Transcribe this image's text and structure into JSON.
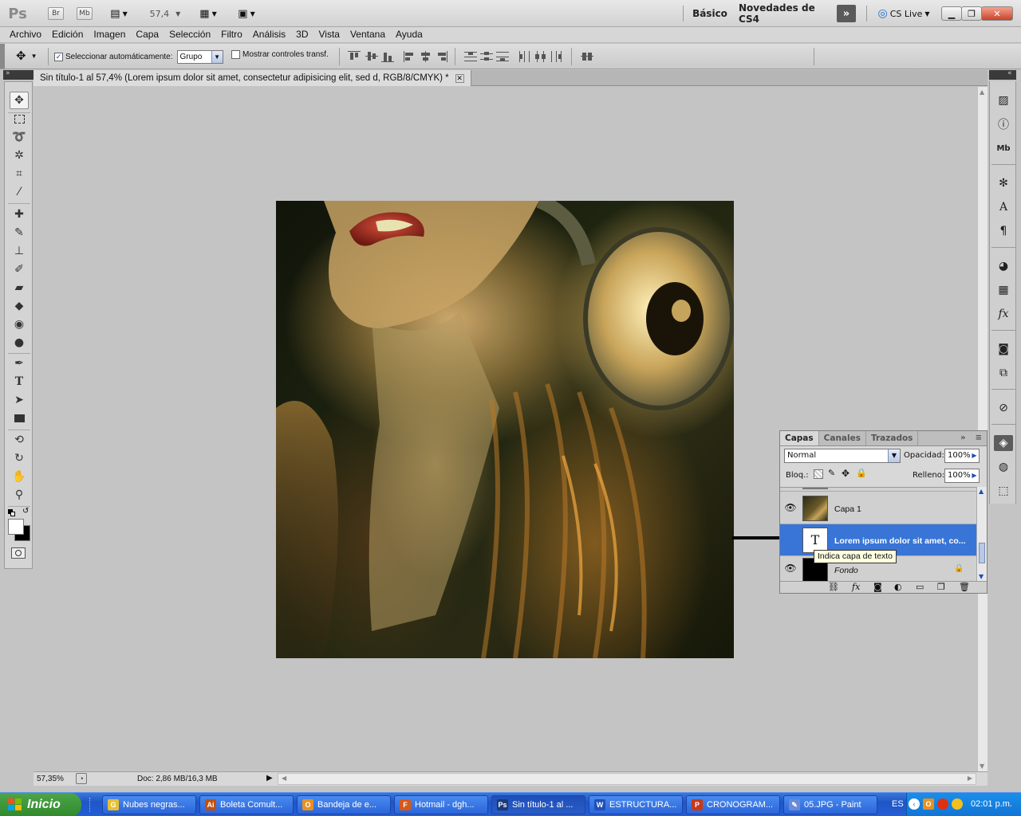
{
  "appbar": {
    "logo": "Ps",
    "bridge_label": "Br",
    "minibridge_label": "Mb",
    "zoom_value": "57,4",
    "workspace_basic": "Básico",
    "workspace_news": "Novedades de CS4",
    "cs_live": "CS Live"
  },
  "menu": [
    "Archivo",
    "Edición",
    "Imagen",
    "Capa",
    "Selección",
    "Filtro",
    "Análisis",
    "3D",
    "Vista",
    "Ventana",
    "Ayuda"
  ],
  "options": {
    "auto_select_label": "Seleccionar automáticamente:",
    "auto_select_checked": true,
    "auto_select_value": "Grupo",
    "show_transform_label": "Mostrar controles transf.",
    "show_transform_checked": false
  },
  "document": {
    "tab_title": "Sin título-1 al 57,4% (Lorem ipsum dolor sit amet, consectetur adipisicing elit, sed d, RGB/8/CMYK) *",
    "status_zoom": "57,35%",
    "status_doc": "Doc: 2,86 MB/16,3 MB"
  },
  "layers_panel": {
    "tabs": [
      "Capas",
      "Canales",
      "Trazados"
    ],
    "blend_mode": "Normal",
    "opacity_label": "Opacidad:",
    "opacity_value": "100%",
    "lock_label": "Bloq.:",
    "fill_label": "Relleno:",
    "fill_value": "100%",
    "layers": [
      {
        "name": "Capa 1",
        "visible": true,
        "selected": false,
        "type": "image"
      },
      {
        "name": "Lorem ipsum dolor sit amet, co...",
        "visible": false,
        "selected": true,
        "type": "text"
      },
      {
        "name": "Fondo",
        "visible": true,
        "selected": false,
        "type": "background",
        "locked": true
      }
    ],
    "tooltip": "Indica capa de texto"
  },
  "taskbar": {
    "start_label": "Inicio",
    "items": [
      {
        "label": "Nubes negras...",
        "icon": "chrome-icon",
        "color": "#e8c030",
        "glyph": "G"
      },
      {
        "label": "Boleta Comult...",
        "icon": "illustrator-icon",
        "color": "#c05010",
        "glyph": "Ai"
      },
      {
        "label": "Bandeja de e...",
        "icon": "outlook-icon",
        "color": "#e89020",
        "glyph": "O"
      },
      {
        "label": "Hotmail - dgh...",
        "icon": "firefox-icon",
        "color": "#d85818",
        "glyph": "F"
      },
      {
        "label": "Sin título-1 al ...",
        "icon": "photoshop-icon",
        "color": "#1a3a78",
        "glyph": "Ps",
        "active": true
      },
      {
        "label": "ESTRUCTURA...",
        "icon": "word-icon",
        "color": "#2050b8",
        "glyph": "W"
      },
      {
        "label": "CRONOGRAM...",
        "icon": "powerpoint-icon",
        "color": "#c83818",
        "glyph": "P"
      },
      {
        "label": "05.JPG - Paint",
        "icon": "paint-icon",
        "color": "#6a8ad8",
        "glyph": "✎"
      }
    ],
    "lang": "ES",
    "clock": "02:01 p.m."
  }
}
